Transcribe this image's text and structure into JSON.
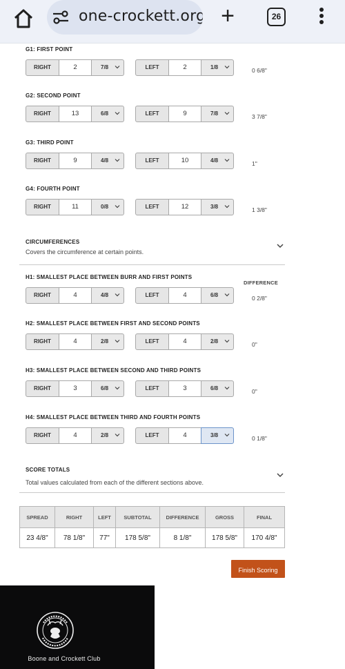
{
  "browser": {
    "url": "one-crockett.org",
    "tab_count": "26"
  },
  "measurements_top": [
    {
      "label": "G1: FIRST POINT",
      "right_tag": "RIGHT",
      "right_value": "2",
      "right_fraction": "7/8",
      "left_tag": "LEFT",
      "left_value": "2",
      "left_fraction": "1/8",
      "difference": "0 6/8\""
    },
    {
      "label": "G2: SECOND POINT",
      "right_tag": "RIGHT",
      "right_value": "13",
      "right_fraction": "6/8",
      "left_tag": "LEFT",
      "left_value": "9",
      "left_fraction": "7/8",
      "difference": "3 7/8\""
    },
    {
      "label": "G3: THIRD POINT",
      "right_tag": "RIGHT",
      "right_value": "9",
      "right_fraction": "4/8",
      "left_tag": "LEFT",
      "left_value": "10",
      "left_fraction": "4/8",
      "difference": "1\""
    },
    {
      "label": "G4: FOURTH POINT",
      "right_tag": "RIGHT",
      "right_value": "11",
      "right_fraction": "0/8",
      "left_tag": "LEFT",
      "left_value": "12",
      "left_fraction": "3/8",
      "difference": "1 3/8\""
    }
  ],
  "circumferences": {
    "title": "CIRCUMFERENCES",
    "description": "Covers the circumference at certain points.",
    "difference_header": "DIFFERENCE"
  },
  "measurements_circ": [
    {
      "label": "H1: SMALLEST PLACE BETWEEN BURR AND FIRST POINTS",
      "right_tag": "RIGHT",
      "right_value": "4",
      "right_fraction": "4/8",
      "left_tag": "LEFT",
      "left_value": "4",
      "left_fraction": "6/8",
      "difference": "0 2/8\""
    },
    {
      "label": "H2: SMALLEST PLACE BETWEEN FIRST AND SECOND POINTS",
      "right_tag": "RIGHT",
      "right_value": "4",
      "right_fraction": "2/8",
      "left_tag": "LEFT",
      "left_value": "4",
      "left_fraction": "2/8",
      "difference": "0\""
    },
    {
      "label": "H3: SMALLEST PLACE BETWEEN SECOND AND THIRD POINTS",
      "right_tag": "RIGHT",
      "right_value": "3",
      "right_fraction": "6/8",
      "left_tag": "LEFT",
      "left_value": "3",
      "left_fraction": "6/8",
      "difference": "0\""
    },
    {
      "label": "H4: SMALLEST PLACE BETWEEN THIRD AND FOURTH POINTS",
      "right_tag": "RIGHT",
      "right_value": "4",
      "right_fraction": "2/8",
      "left_tag": "LEFT",
      "left_value": "4",
      "left_fraction": "3/8",
      "difference": "0 1/8\""
    }
  ],
  "score_totals": {
    "title": "SCORE TOTALS",
    "description": "Total values calculated from each of the different sections above.",
    "headers": [
      "SPREAD",
      "RIGHT",
      "LEFT",
      "SUBTOTAL",
      "DIFFERENCE",
      "GROSS",
      "FINAL"
    ],
    "values": [
      "23 4/8\"",
      "78 1/8\"",
      "77\"",
      "178 5/8\"",
      "8 1/8\"",
      "178 5/8\"",
      "170 4/8\""
    ]
  },
  "finish_button": {
    "label": "Finish Scoring"
  },
  "footer": {
    "name": "Boone and Crockett Club",
    "logo_text": "BOONE AND CROCKETT CLUB"
  },
  "colors": {
    "accent": "#c2521a",
    "footer_bg": "#0b0b0c",
    "browser_bar": "#eef1f8",
    "focus": "#6b93c9"
  }
}
